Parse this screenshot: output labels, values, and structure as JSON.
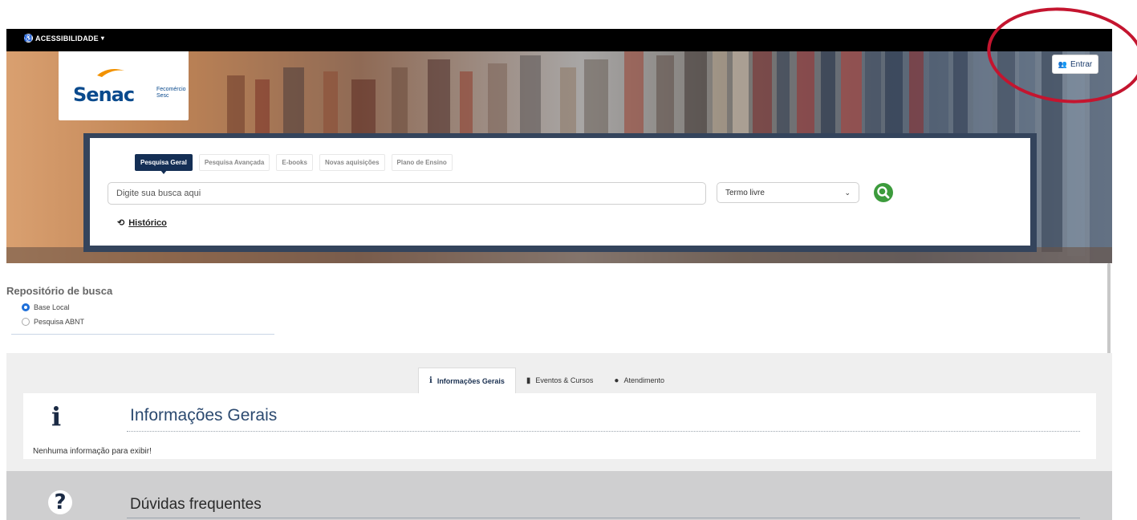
{
  "accessibility": {
    "label": "ACESSIBILIDADE",
    "icon": "accessibility-icon"
  },
  "logo": {
    "brand": "Senac",
    "sub_line1": "Fecomércio",
    "sub_line2": "Sesc",
    "brand_color": "#0a4a8d"
  },
  "header": {
    "login_label": "Entrar",
    "login_icon": "users-icon"
  },
  "search": {
    "tabs": [
      {
        "label": "Pesquisa Geral",
        "active": true
      },
      {
        "label": "Pesquisa Avançada",
        "active": false
      },
      {
        "label": "E-books",
        "active": false
      },
      {
        "label": "Novas aquisições",
        "active": false
      },
      {
        "label": "Plano de Ensino",
        "active": false
      }
    ],
    "placeholder": "Digite sua busca aqui",
    "select_value": "Termo livre",
    "history_label": "Histórico",
    "button_color": "#3c9b3c"
  },
  "repository": {
    "title": "Repositório de busca",
    "options": [
      {
        "label": "Base Local",
        "selected": true
      },
      {
        "label": "Pesquisa ABNT",
        "selected": false
      }
    ]
  },
  "info_tabs": [
    {
      "label": "Informações Gerais",
      "icon": "info-icon",
      "active": true
    },
    {
      "label": "Eventos & Cursos",
      "icon": "bookmark-icon",
      "active": false
    },
    {
      "label": "Atendimento",
      "icon": "clock-icon",
      "active": false
    }
  ],
  "info": {
    "title": "Informações Gerais",
    "empty_message": "Nenhuma informação para exibir!"
  },
  "faq": {
    "title": "Dúvidas frequentes"
  },
  "colors": {
    "primary": "#142f55",
    "annotation": "#c4152f"
  }
}
